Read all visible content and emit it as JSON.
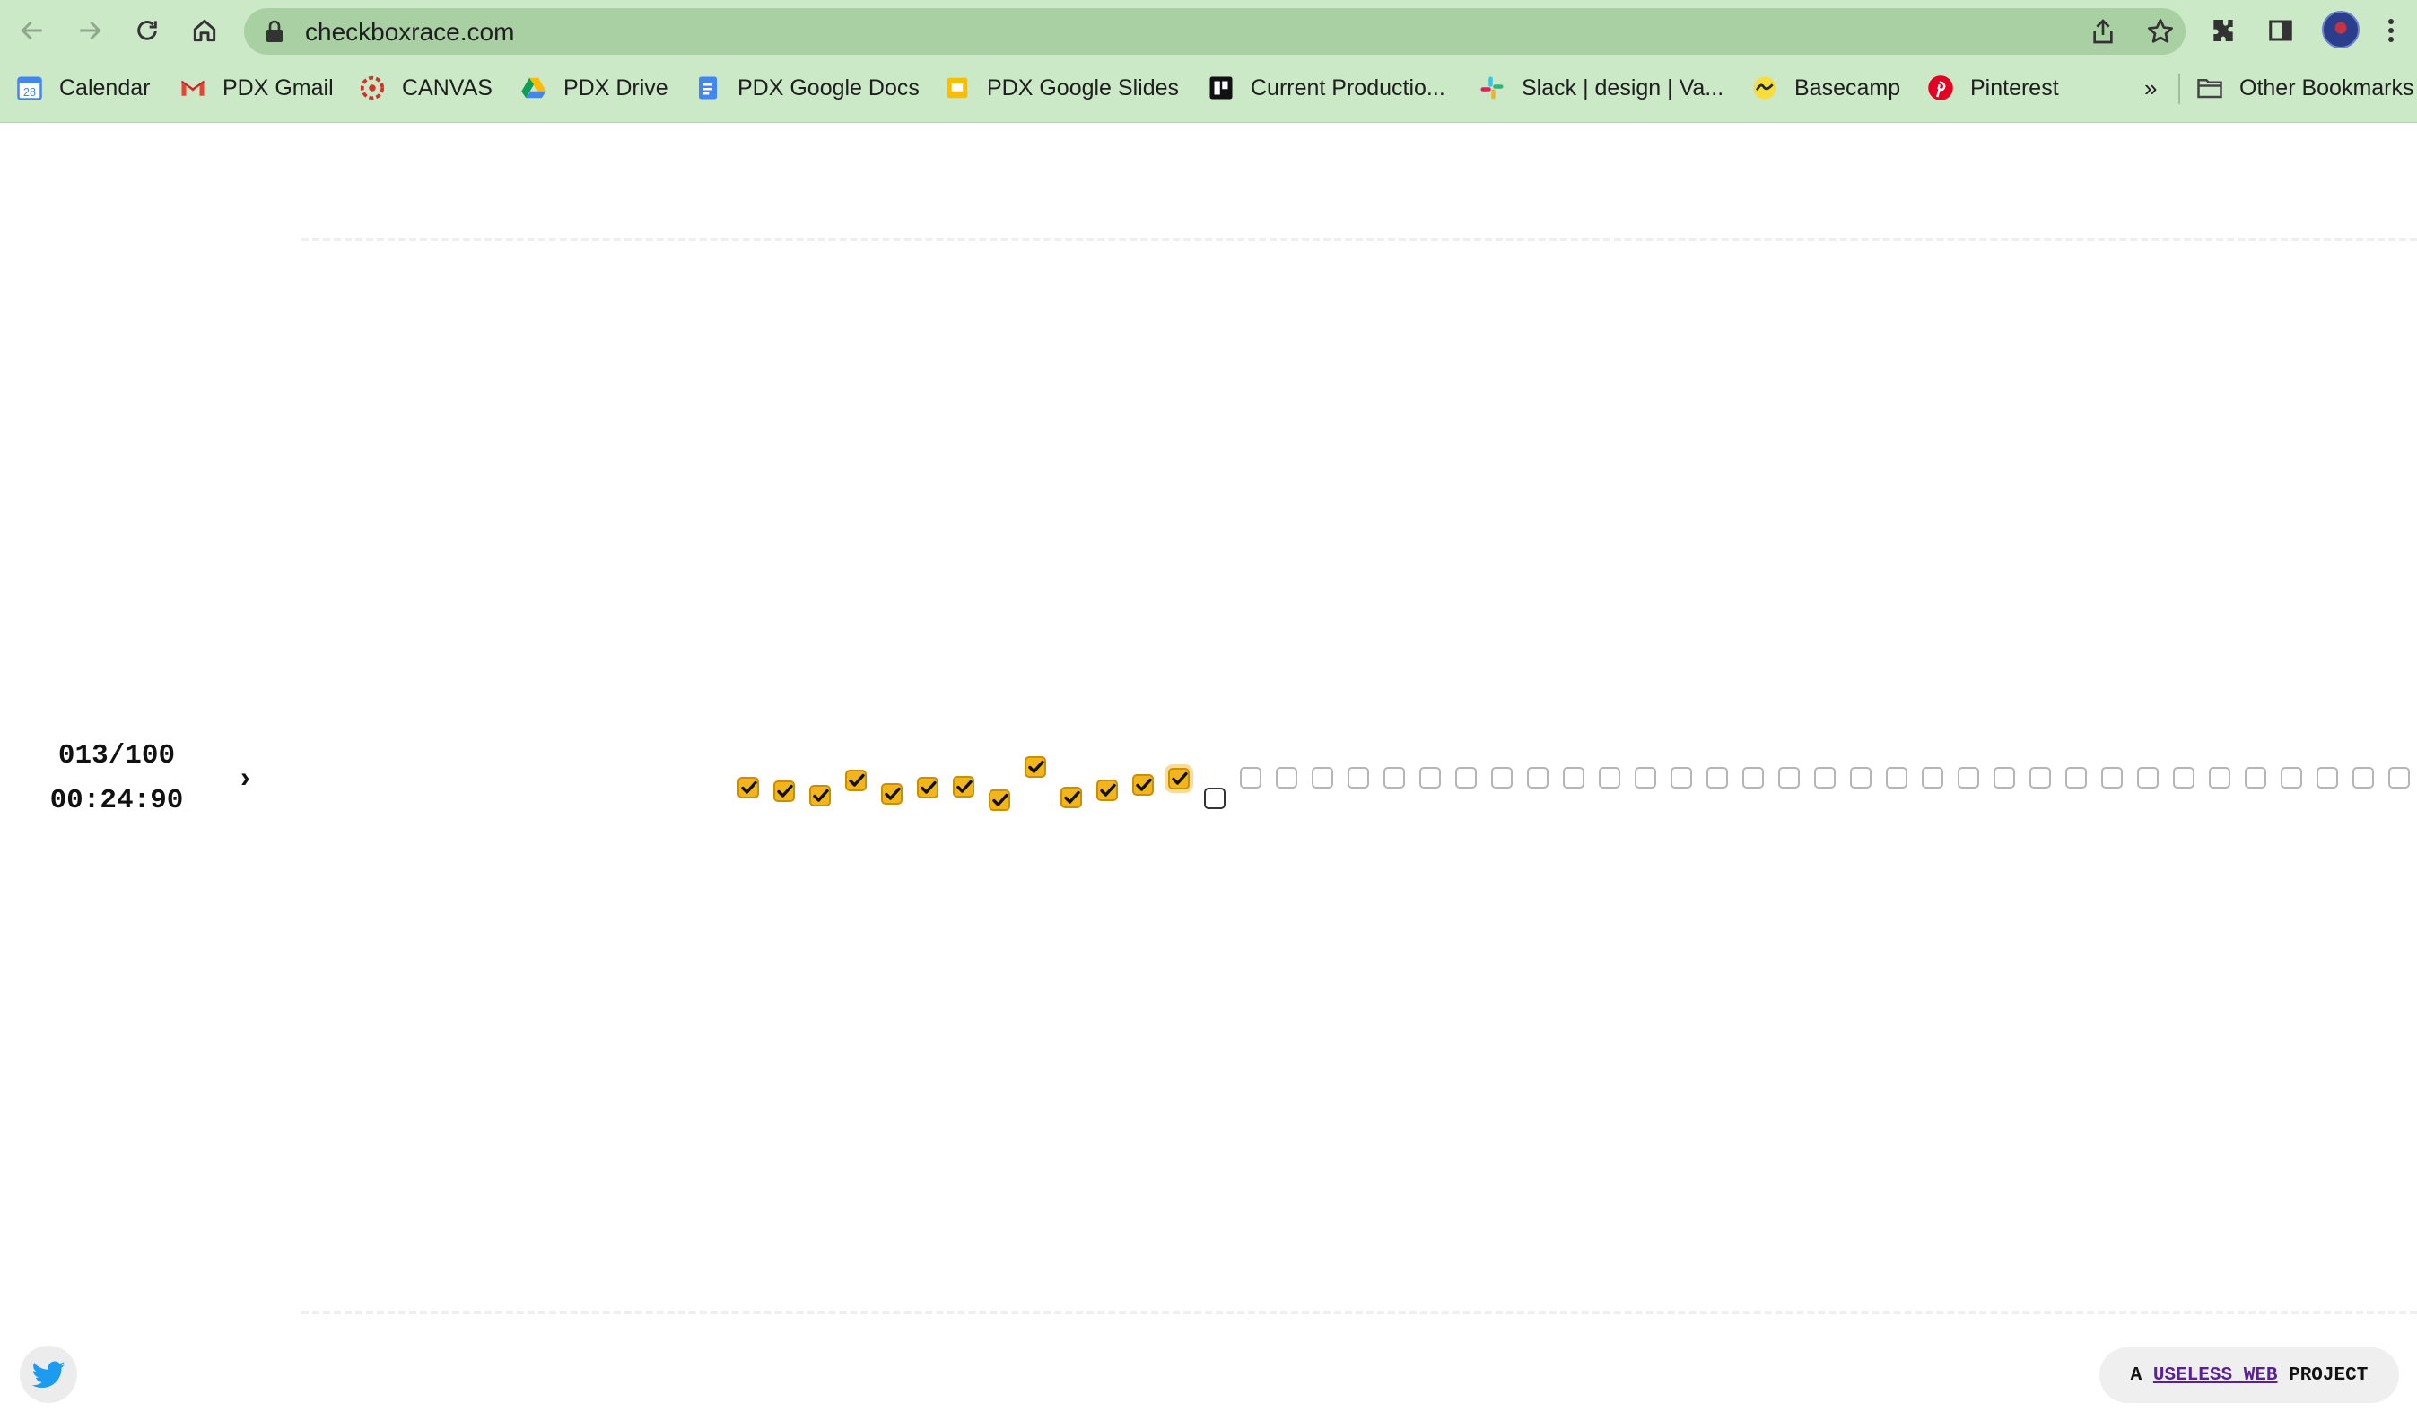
{
  "browser": {
    "url": "checkboxrace.com",
    "bookmarks": [
      {
        "label": "Calendar",
        "icon": "calendar-icon"
      },
      {
        "label": "PDX Gmail",
        "icon": "gmail-icon"
      },
      {
        "label": "CANVAS",
        "icon": "canvas-icon"
      },
      {
        "label": "PDX Drive",
        "icon": "drive-icon"
      },
      {
        "label": "PDX Google Docs",
        "icon": "docs-icon"
      },
      {
        "label": "PDX Google Slides",
        "icon": "slides-icon"
      },
      {
        "label": "Current Productio...",
        "icon": "trello-icon"
      },
      {
        "label": "Slack | design | Va...",
        "icon": "slack-icon"
      },
      {
        "label": "Basecamp",
        "icon": "basecamp-icon"
      },
      {
        "label": "Pinterest",
        "icon": "pinterest-icon"
      }
    ],
    "more_bookmarks": "»",
    "other_bookmarks": "Other Bookmarks"
  },
  "game": {
    "count": "013/100",
    "timer": "00:24:90",
    "arrow": "›",
    "checked_count": 13,
    "total_visible": 47
  },
  "footer": {
    "badge_prefix": "A ",
    "badge_link": "USELESS WEB",
    "badge_suffix": " PROJECT"
  },
  "colors": {
    "checked_fill": "#f3b51c",
    "chrome_bg": "#cbe8c7",
    "twitter_blue": "#1d9bf0"
  }
}
